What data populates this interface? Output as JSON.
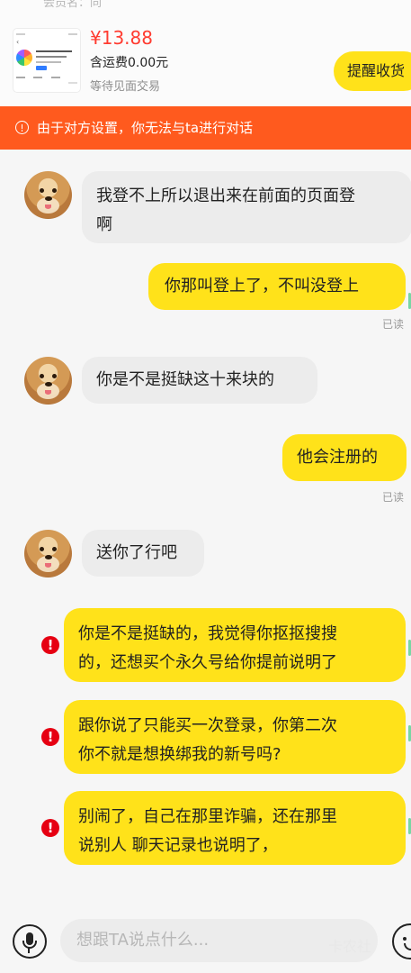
{
  "header": {
    "cut_text": "会员名：同"
  },
  "product": {
    "price": "¥13.88",
    "shipping": "含运费0.00元",
    "status": "等待见面交易",
    "remind_label": "提醒收货"
  },
  "notice": {
    "text": "由于对方设置，你无法与ta进行对话"
  },
  "messages": [
    {
      "text_lines": [
        "我登不上所以退出来在前面的页面登",
        "啊"
      ]
    },
    {
      "text_lines": [
        "你那叫登上了，不叫没登上"
      ]
    },
    {
      "text_lines": [
        "你是不是挺缺这十来块的"
      ]
    },
    {
      "text_lines": [
        "他会注册的"
      ]
    },
    {
      "text_lines": [
        "送你了行吧"
      ]
    },
    {
      "text_lines": [
        "你是不是挺缺的，我觉得你抠抠搜搜",
        "的，还想买个永久号给你提前说明了"
      ]
    },
    {
      "text_lines": [
        "跟你说了只能买一次登录，你第二次",
        "你不就是想换绑我的新号吗?"
      ]
    },
    {
      "text_lines": [
        "别闹了，自己在那里诈骗，还在那里",
        "说别人 聊天记录也说明了，"
      ]
    }
  ],
  "read_status": "已读",
  "input": {
    "placeholder": "想跟TA说点什么..."
  },
  "watermark": "卡农社",
  "icons": {
    "notice": "info-circle-icon",
    "error": "exclamation-circle-icon",
    "mic": "microphone-icon",
    "emoji": "smile-icon"
  },
  "colors": {
    "accent_yellow": "#ffe21a",
    "notice_orange": "#ff5a1e",
    "price_red": "#ff3b30",
    "error_red": "#e60012"
  }
}
